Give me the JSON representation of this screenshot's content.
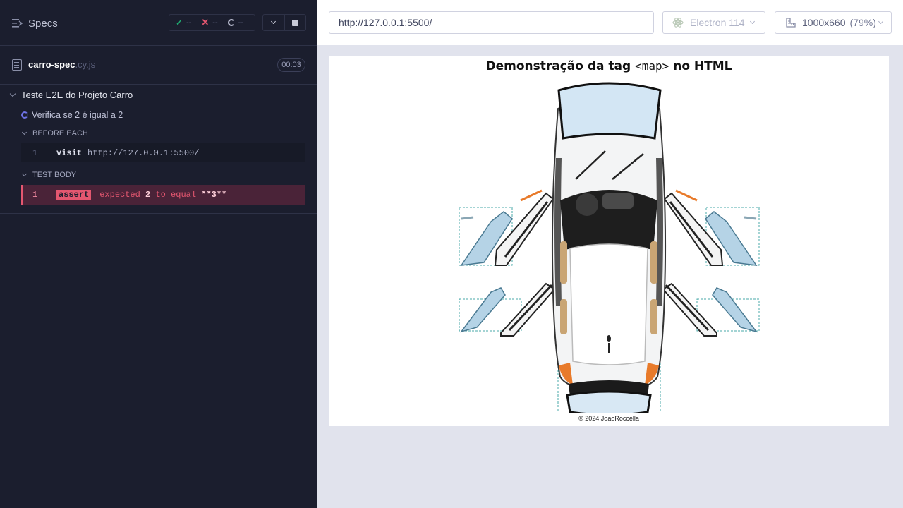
{
  "runner": {
    "header": {
      "title": "Specs",
      "passed": "--",
      "failed": "--",
      "pending": "--"
    },
    "spec": {
      "name": "carro-spec",
      "ext": ".cy.js",
      "duration": "00:03"
    },
    "suite": {
      "title": "Teste E2E do Projeto Carro"
    },
    "test": {
      "title": "Verifica se 2 é igual a 2"
    },
    "hooks": {
      "before_each": {
        "label": "BEFORE EACH",
        "commands": [
          {
            "number": "1",
            "name": "visit",
            "arg": "http://127.0.0.1:5500/"
          }
        ]
      },
      "test_body": {
        "label": "TEST BODY",
        "commands": [
          {
            "number": "1",
            "name": "assert",
            "msg_expected": "expected",
            "msg_value": "2",
            "msg_to_equal": "to equal",
            "msg_actual": "**3**"
          }
        ]
      }
    },
    "colors": {
      "pass": "#1fa971",
      "fail": "#e45770",
      "pending": "#6f73e8"
    }
  },
  "aut": {
    "url": "http://127.0.0.1:5500/",
    "browser": "Electron 114",
    "viewport": "1000x660",
    "zoom": "(79%)",
    "page": {
      "title_prefix": "Demonstração da tag ",
      "title_code": "<map>",
      "title_suffix": " no HTML",
      "footer": "© 2024 JoaoRoccella"
    }
  }
}
